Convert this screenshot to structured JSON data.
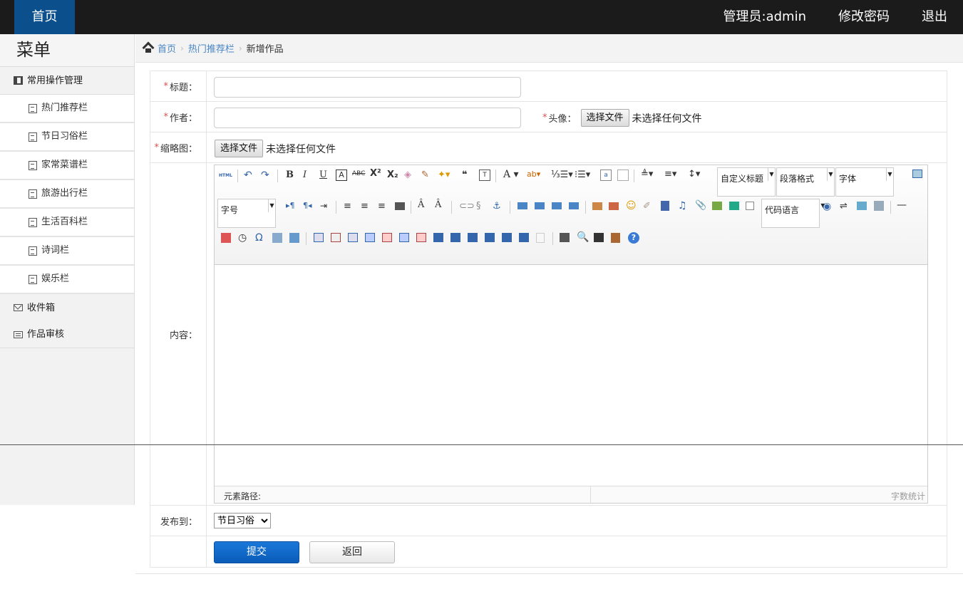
{
  "topbar": {
    "home": "首页",
    "admin": "管理员:admin",
    "change_password": "修改密码",
    "logout": "退出"
  },
  "sidebar": {
    "title": "菜单",
    "group_common": "常用操作管理",
    "items": [
      "热门推荐栏",
      "节日习俗栏",
      "家常菜谱栏",
      "旅游出行栏",
      "生活百科栏",
      "诗词栏",
      "娱乐栏"
    ],
    "inbox": "收件箱",
    "review": "作品审核"
  },
  "breadcrumb": {
    "home": "首页",
    "section": "热门推荐栏",
    "current": "新增作品",
    "separator": "›"
  },
  "form": {
    "required_mark": "*",
    "title_label": "标题：",
    "author_label": "作者：",
    "avatar_label": "头像：",
    "thumbnail_label": "缩略图：",
    "content_label": "内容：",
    "publish_label": "发布到：",
    "title_value": "",
    "author_value": "",
    "file_button": "选择文件",
    "no_file": "未选择任何文件",
    "publish_selected": "节日习俗",
    "submit": "提交",
    "back": "返回"
  },
  "editor": {
    "custom_title": "自定义标题",
    "paragraph_format": "段落格式",
    "font": "字体",
    "font_size": "字号",
    "code_language": "代码语言",
    "element_path": "元素路径:",
    "word_count": "字数统计",
    "html_icon_text": "HTML"
  },
  "colors": {
    "topbar_bg": "#1b1b1b",
    "home_bg": "#0b4f8c",
    "link": "#4a86c5",
    "required": "#d9534f",
    "submit_bg": "#1a78d9"
  }
}
